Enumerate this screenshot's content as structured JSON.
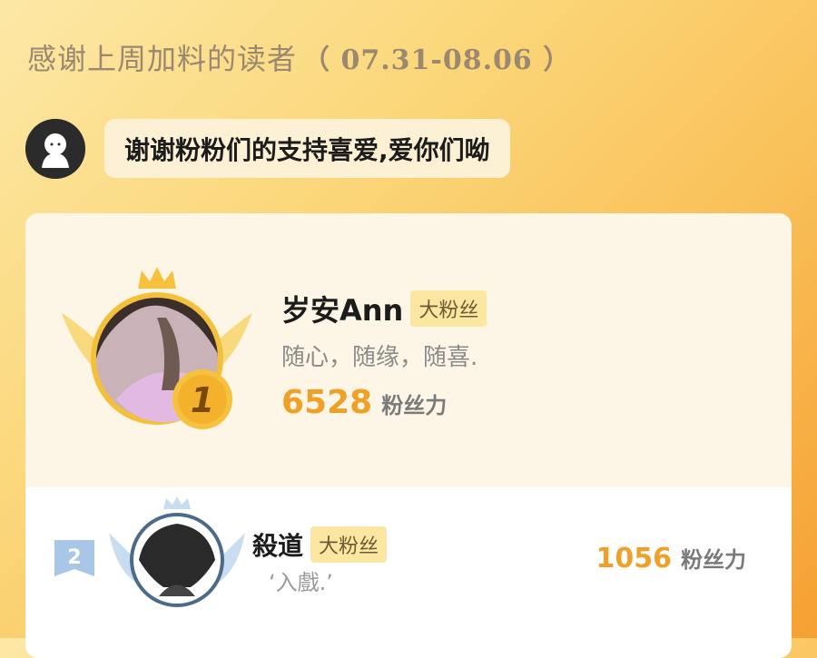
{
  "header": {
    "title": "感谢上周加料的读者",
    "date_range": "（ 07.31-08.06 ）"
  },
  "author": {
    "message": "谢谢粉粉们的支持喜爱,爱你们呦",
    "avatar_icon": "ghost-avatar-icon"
  },
  "leaderboard": [
    {
      "rank": "1",
      "name": "岁安Ann",
      "badge": "大粉丝",
      "motto": "随心，随缘，随喜.",
      "score": "6528",
      "score_label": "粉丝力"
    },
    {
      "rank": "2",
      "name": "殺道",
      "badge": "大粉丝",
      "motto": "‘入戲.’",
      "score": "1056",
      "score_label": "粉丝力"
    }
  ],
  "colors": {
    "accent": "#f0a028",
    "badge_bg": "#fce7a2",
    "gold": "#f6c23e"
  }
}
